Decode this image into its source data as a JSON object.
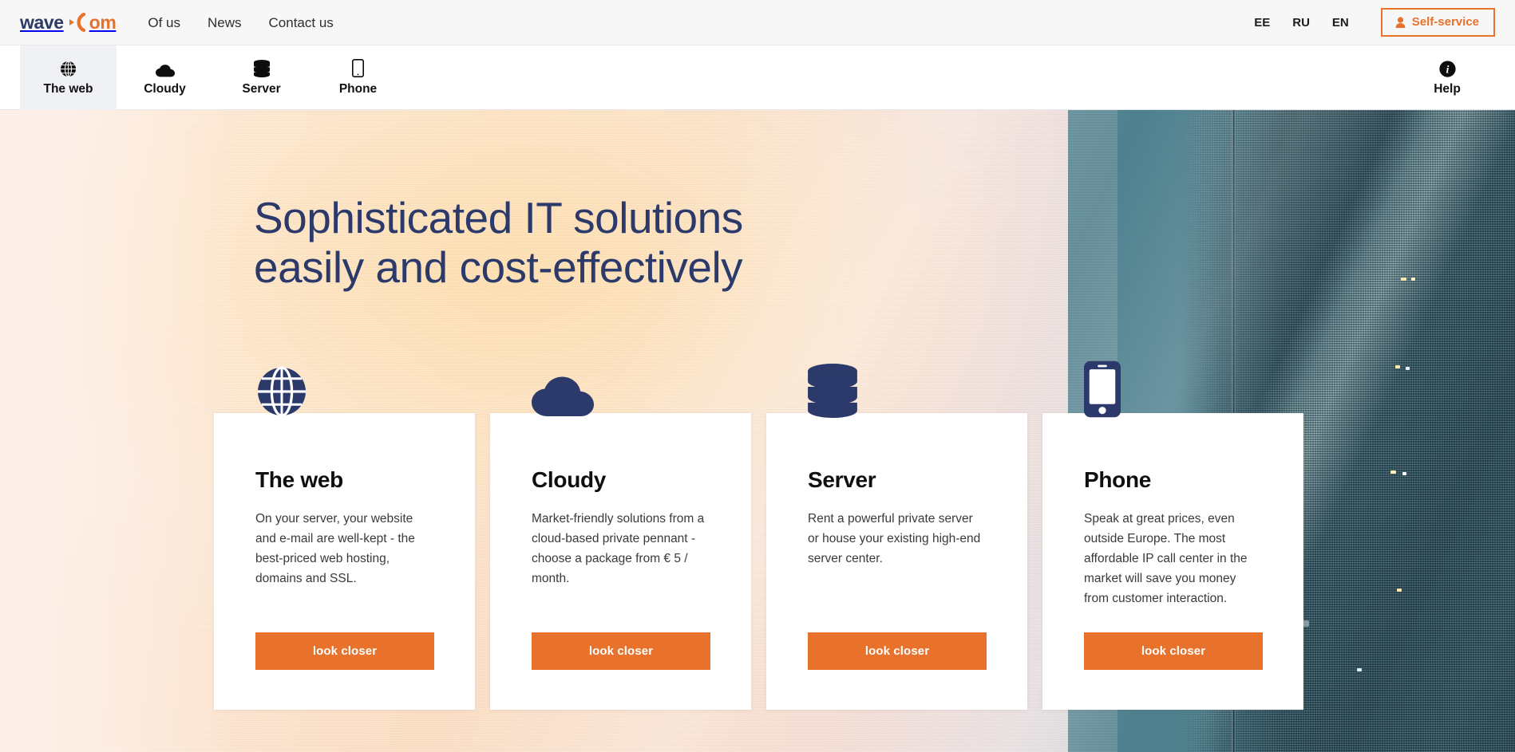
{
  "brand": {
    "name_dark": "wave",
    "name_accent": "om",
    "accent_color": "#e8722b",
    "navy_color": "#2c3a6b"
  },
  "topbar": {
    "nav": [
      {
        "label": "Of us"
      },
      {
        "label": "News"
      },
      {
        "label": "Contact us"
      }
    ],
    "languages": [
      {
        "code": "EE"
      },
      {
        "code": "RU"
      },
      {
        "code": "EN"
      }
    ],
    "self_service": {
      "label": "Self-service",
      "icon": "user-icon"
    }
  },
  "servicenav": {
    "items": [
      {
        "label": "The web",
        "icon": "globe-icon",
        "active": true
      },
      {
        "label": "Cloudy",
        "icon": "cloud-icon",
        "active": false
      },
      {
        "label": "Server",
        "icon": "database-icon",
        "active": false
      },
      {
        "label": "Phone",
        "icon": "mobile-icon",
        "active": false
      }
    ],
    "help": {
      "label": "Help",
      "icon": "info-circle-icon"
    }
  },
  "hero": {
    "title": "Sophisticated IT solutions\neasily and cost-effectively"
  },
  "cards": [
    {
      "icon": "globe-icon",
      "title": "The web",
      "text": "On your server, your website and e-mail are well-kept - the best-priced web hosting, domains and SSL.",
      "button": "look closer"
    },
    {
      "icon": "cloud-icon",
      "title": "Cloudy",
      "text": "Market-friendly solutions from a cloud-based private pennant - choose a package from € 5 / month.",
      "button": "look closer"
    },
    {
      "icon": "database-icon",
      "title": "Server",
      "text": "Rent a powerful private server or house your existing high-end server center.",
      "button": "look closer"
    },
    {
      "icon": "mobile-icon",
      "title": "Phone",
      "text": "Speak at great prices, even outside Europe. The most affordable IP call center in the market will save you money from customer interaction.",
      "button": "look closer"
    }
  ]
}
